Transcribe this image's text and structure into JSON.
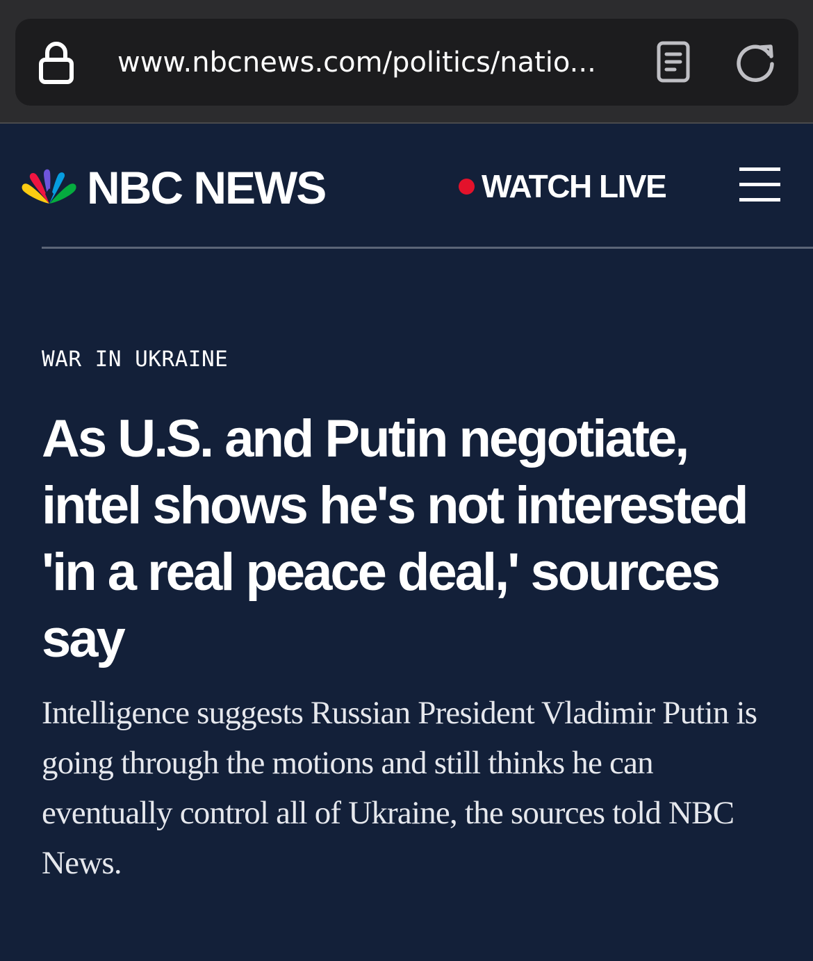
{
  "browser": {
    "url": "www.nbcnews.com/politics/natio...",
    "icons": {
      "lock": "lock-icon",
      "reader": "reader-mode-icon",
      "reload": "reload-icon"
    }
  },
  "header": {
    "brand": "NBC NEWS",
    "watch_live": "WATCH LIVE",
    "live_dot_color": "#e3122b",
    "menu_icon": "hamburger-menu-icon"
  },
  "article": {
    "section": "WAR IN UKRAINE",
    "headline": "As U.S. and Putin negotiate, intel shows he's not interested 'in a real peace deal,' sources say",
    "dek": "Intelligence suggests Russian President Vladimir Putin is going through the motions and still thinks he can eventually control all of Ukraine, the sources told NBC News."
  },
  "colors": {
    "page_background": "#132039",
    "chrome_background": "#2c2c2e",
    "address_bar": "#1c1c1e"
  }
}
